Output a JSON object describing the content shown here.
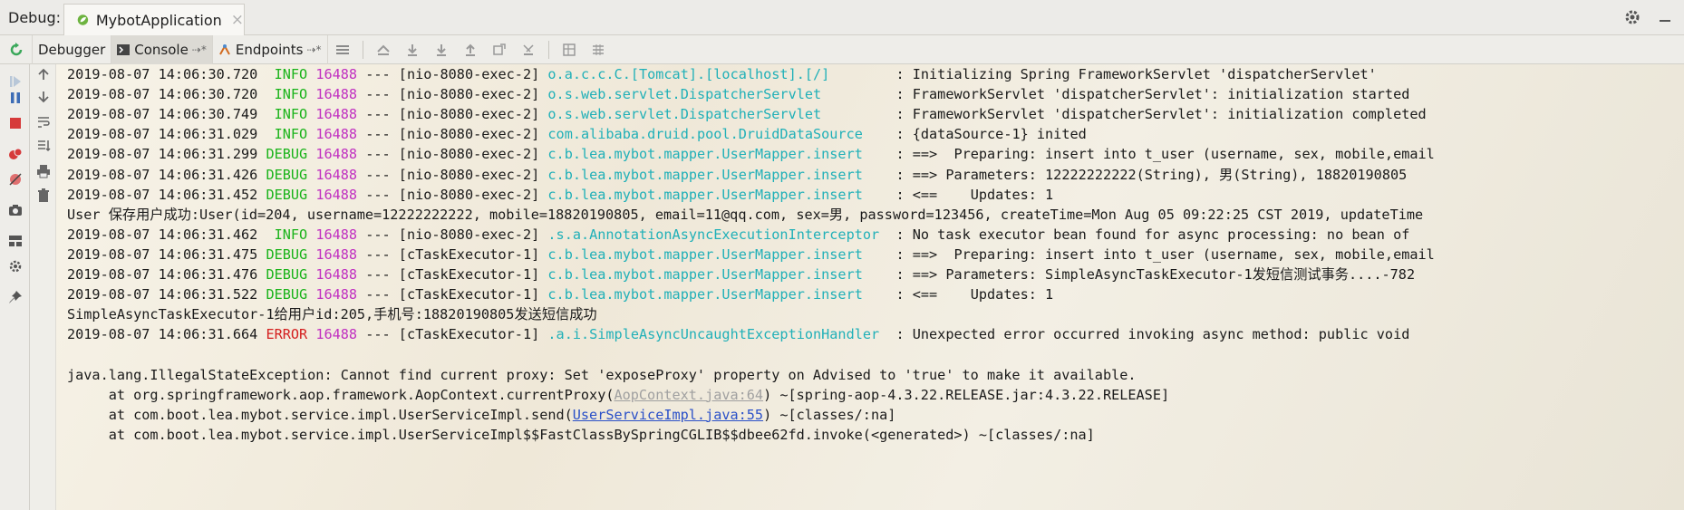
{
  "titlebar": {
    "debug_label": "Debug:",
    "app_tab": "MybotApplication",
    "close": "×"
  },
  "toolbar": {
    "tabs": [
      {
        "label": "Debugger"
      },
      {
        "label": "Console"
      },
      {
        "label": "Endpoints"
      }
    ],
    "pin": "⇢*"
  },
  "log_lines": [
    {
      "ts": "2019-08-07 14:06:30.720",
      "level": " INFO",
      "pid": "16488",
      "sep": "---",
      "thread": "[nio-8080-exec-2]",
      "logger": "o.a.c.c.C.[Tomcat].[localhost].[/]       ",
      "msg": ": Initializing Spring FrameworkServlet 'dispatcherServlet'"
    },
    {
      "ts": "2019-08-07 14:06:30.720",
      "level": " INFO",
      "pid": "16488",
      "sep": "---",
      "thread": "[nio-8080-exec-2]",
      "logger": "o.s.web.servlet.DispatcherServlet        ",
      "msg": ": FrameworkServlet 'dispatcherServlet': initialization started"
    },
    {
      "ts": "2019-08-07 14:06:30.749",
      "level": " INFO",
      "pid": "16488",
      "sep": "---",
      "thread": "[nio-8080-exec-2]",
      "logger": "o.s.web.servlet.DispatcherServlet        ",
      "msg": ": FrameworkServlet 'dispatcherServlet': initialization completed"
    },
    {
      "ts": "2019-08-07 14:06:31.029",
      "level": " INFO",
      "pid": "16488",
      "sep": "---",
      "thread": "[nio-8080-exec-2]",
      "logger": "com.alibaba.druid.pool.DruidDataSource   ",
      "msg": ": {dataSource-1} inited"
    },
    {
      "ts": "2019-08-07 14:06:31.299",
      "level": "DEBUG",
      "pid": "16488",
      "sep": "---",
      "thread": "[nio-8080-exec-2]",
      "logger": "c.b.lea.mybot.mapper.UserMapper.insert   ",
      "msg": ": ==>  Preparing: insert into t_user (username, sex, mobile,email"
    },
    {
      "ts": "2019-08-07 14:06:31.426",
      "level": "DEBUG",
      "pid": "16488",
      "sep": "---",
      "thread": "[nio-8080-exec-2]",
      "logger": "c.b.lea.mybot.mapper.UserMapper.insert   ",
      "msg": ": ==> Parameters: 12222222222(String), 男(String), 18820190805"
    },
    {
      "ts": "2019-08-07 14:06:31.452",
      "level": "DEBUG",
      "pid": "16488",
      "sep": "---",
      "thread": "[nio-8080-exec-2]",
      "logger": "c.b.lea.mybot.mapper.UserMapper.insert   ",
      "msg": ": <==    Updates: 1"
    },
    {
      "plain": "User 保存用户成功:User(id=204, username=12222222222, mobile=18820190805, email=11@qq.com, sex=男, password=123456, createTime=Mon Aug 05 09:22:25 CST 2019, updateTime"
    },
    {
      "ts": "2019-08-07 14:06:31.462",
      "level": " INFO",
      "pid": "16488",
      "sep": "---",
      "thread": "[nio-8080-exec-2]",
      "logger": ".s.a.AnnotationAsyncExecutionInterceptor ",
      "msg": ": No task executor bean found for async processing: no bean of"
    },
    {
      "ts": "2019-08-07 14:06:31.475",
      "level": "DEBUG",
      "pid": "16488",
      "sep": "---",
      "thread": "[cTaskExecutor-1]",
      "logger": "c.b.lea.mybot.mapper.UserMapper.insert   ",
      "msg": ": ==>  Preparing: insert into t_user (username, sex, mobile,email"
    },
    {
      "ts": "2019-08-07 14:06:31.476",
      "level": "DEBUG",
      "pid": "16488",
      "sep": "---",
      "thread": "[cTaskExecutor-1]",
      "logger": "c.b.lea.mybot.mapper.UserMapper.insert   ",
      "msg": ": ==> Parameters: SimpleAsyncTaskExecutor-1发短信测试事务....-782"
    },
    {
      "ts": "2019-08-07 14:06:31.522",
      "level": "DEBUG",
      "pid": "16488",
      "sep": "---",
      "thread": "[cTaskExecutor-1]",
      "logger": "c.b.lea.mybot.mapper.UserMapper.insert   ",
      "msg": ": <==    Updates: 1"
    },
    {
      "plain": "SimpleAsyncTaskExecutor-1给用户id:205,手机号:18820190805发送短信成功"
    },
    {
      "ts": "2019-08-07 14:06:31.664",
      "level": "ERROR",
      "pid": "16488",
      "sep": "---",
      "thread": "[cTaskExecutor-1]",
      "logger": ".a.i.SimpleAsyncUncaughtExceptionHandler ",
      "msg": ": Unexpected error occurred invoking async method: public void"
    },
    {
      "plain": ""
    },
    {
      "plain": "java.lang.IllegalStateException: Cannot find current proxy: Set 'exposeProxy' property on Advised to 'true' to make it available."
    },
    {
      "stack": "\tat org.springframework.aop.framework.AopContext.currentProxy(",
      "link": "AopContext.java:64",
      "link_kind": "grey",
      "after": ") ~[spring-aop-4.3.22.RELEASE.jar:4.3.22.RELEASE]"
    },
    {
      "stack": "\tat com.boot.lea.mybot.service.impl.UserServiceImpl.send(",
      "link": "UserServiceImpl.java:55",
      "link_kind": "blue",
      "after": ") ~[classes/:na]"
    },
    {
      "stack": "\tat com.boot.lea.mybot.service.impl.UserServiceImpl$$FastClassBySpringCGLIB$$dbee62fd.invoke(",
      "link": "<generated>",
      "link_kind": "none",
      "after": ") ~[classes/:na]"
    }
  ]
}
